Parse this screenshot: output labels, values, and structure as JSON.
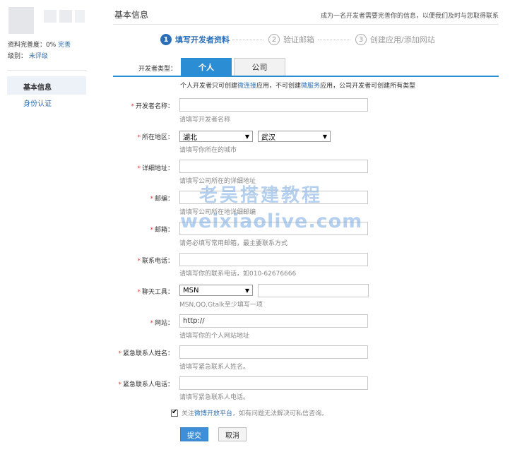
{
  "sidebar": {
    "completeness_label": "资料完善度：0%",
    "completeness_link": "完善",
    "level_label": "级别：",
    "level_value": "未评级",
    "nav": [
      "基本信息",
      "身份认证"
    ]
  },
  "header": {
    "title": "基本信息",
    "tip": "成为一名开发者需要完善你的信息，以便我们及时与您取得联系"
  },
  "steps": [
    {
      "num": "1",
      "label": "填写开发者资料"
    },
    {
      "num": "2",
      "label": "验证邮箱"
    },
    {
      "num": "3",
      "label": "创建应用/添加网站"
    }
  ],
  "dev_type": {
    "label": "开发者类型：",
    "tabs": [
      "个人",
      "公司"
    ],
    "desc_1": "个人开发者只可创建",
    "desc_link1": "微连接",
    "desc_2": "应用，不可创建",
    "desc_link2": "微服务",
    "desc_3": "应用，公司开发者可创建所有类型"
  },
  "form": {
    "dev_name": {
      "label": "开发者名称：",
      "value": "",
      "hint": "请填写开发者名称"
    },
    "region": {
      "label": "所在地区：",
      "province": "湖北",
      "city": "武汉",
      "hint": "请填写你所在的城市"
    },
    "address": {
      "label": "详细地址：",
      "value": "",
      "hint": "请填写公司所在的详细地址"
    },
    "zipcode": {
      "label": "邮编：",
      "value": "",
      "hint": "请填写公司所在地详细邮编"
    },
    "email": {
      "label": "邮箱：",
      "value": "",
      "hint": "请务必填写常用邮箱，最主要联系方式"
    },
    "phone": {
      "label": "联系电话：",
      "value": "",
      "hint": "请填写你的联系电话，如010-62676666"
    },
    "im": {
      "label": "聊天工具：",
      "type": "MSN",
      "value": "",
      "hint": "MSN,QQ,Gtalk至少填写一项"
    },
    "website": {
      "label": "网站：",
      "value": "http://",
      "hint": "请填写你的个人网站地址"
    },
    "emergency_name": {
      "label": "紧急联系人姓名：",
      "value": "",
      "hint": "请填写紧急联系人姓名。"
    },
    "emergency_phone": {
      "label": "紧急联系人电话：",
      "value": "",
      "hint": "请填写紧急联系人电话。"
    },
    "required_mark": "*"
  },
  "agree": {
    "prefix": "关注",
    "link": "微博开放平台",
    "suffix": "，如有问题无法解决可私信咨询。"
  },
  "buttons": {
    "submit": "提交",
    "cancel": "取消"
  },
  "watermark": {
    "line1": "老吴搭建教程",
    "line2": "weixiaolive.com"
  },
  "colors": {
    "accent": "#2b8ed4",
    "link": "#2b6fb6",
    "required": "#e04040"
  }
}
